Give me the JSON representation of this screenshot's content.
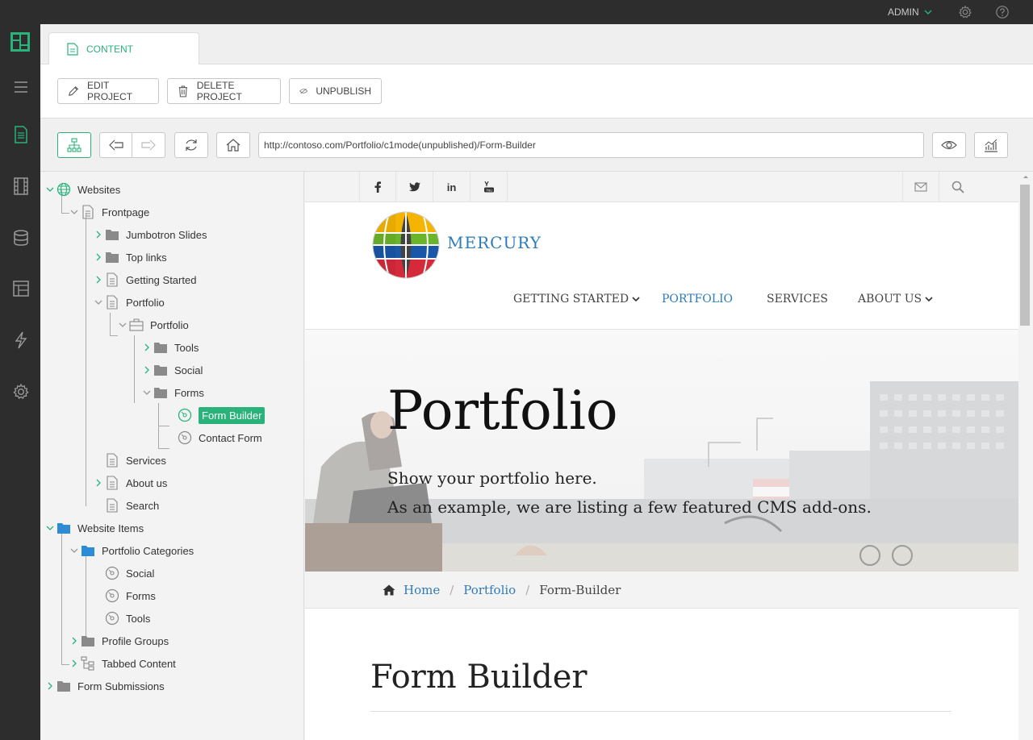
{
  "topbar": {
    "user": "ADMIN",
    "icons": [
      "gear-icon",
      "help-icon"
    ]
  },
  "sidebar": {
    "icons": [
      "logo-icon",
      "hamburger-icon",
      "content-icon",
      "media-icon",
      "data-icon",
      "layout-icon",
      "functions-icon",
      "settings-icon"
    ]
  },
  "tabs": [
    {
      "label": "CONTENT"
    }
  ],
  "toolbar": {
    "edit_label": "EDIT PROJECT",
    "delete_label": "DELETE PROJECT",
    "unpublish_label": "UNPUBLISH"
  },
  "address": {
    "url": "http://contoso.com/Portfolio/c1mode(unpublished)/Form-Builder"
  },
  "tree": {
    "websites": "Websites",
    "frontpage": "Frontpage",
    "jumbotron": "Jumbotron Slides",
    "toplinks": "Top links",
    "gettingstarted": "Getting Started",
    "portfolio_page": "Portfolio",
    "portfolio_app": "Portfolio",
    "tools": "Tools",
    "social": "Social",
    "forms": "Forms",
    "formbuilder": "Form Builder",
    "contactform": "Contact Form",
    "services": "Services",
    "aboutus": "About us",
    "search": "Search",
    "websiteitems": "Website Items",
    "portfoliocats": "Portfolio Categories",
    "cat_social": "Social",
    "cat_forms": "Forms",
    "cat_tools": "Tools",
    "profilegroups": "Profile Groups",
    "tabbed": "Tabbed Content",
    "formsubs": "Form Submissions"
  },
  "preview": {
    "brand": "MERCURY",
    "nav": [
      "GETTING STARTED",
      "PORTFOLIO",
      "SERVICES",
      "ABOUT US"
    ],
    "hero_title": "Portfolio",
    "hero_line1": "Show your portfolio here.",
    "hero_line2": "As an example, we are listing a few featured CMS add-ons.",
    "breadcrumb": [
      "Home",
      "Portfolio",
      "Form-Builder"
    ],
    "page_title": "Form Builder"
  },
  "colors": {
    "accent": "#2ab27b",
    "link": "#2e7bb8",
    "dark": "#2d2d2d"
  }
}
